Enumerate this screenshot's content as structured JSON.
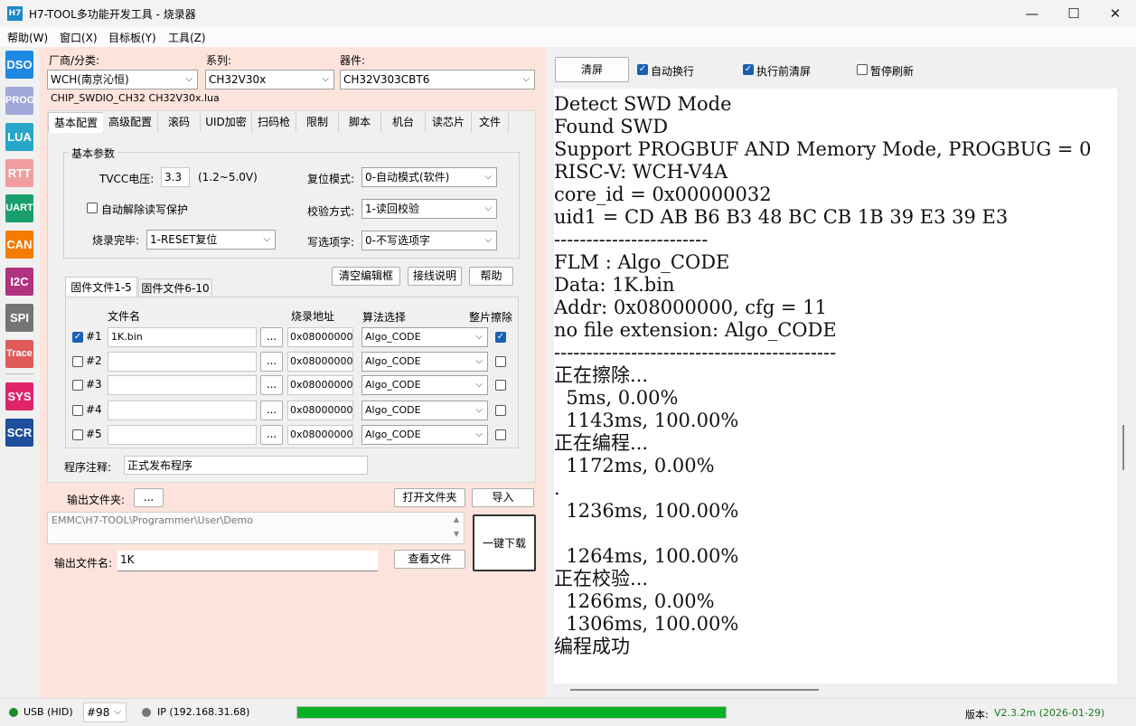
{
  "window": {
    "app_icon_text": "H7",
    "title": "H7-TOOL多功能开发工具 - 烧录器",
    "minimize": "—",
    "maximize": "☐",
    "close": "✕"
  },
  "menu": [
    "帮助(W)",
    "窗口(X)",
    "目标板(Y)",
    "工具(Z)"
  ],
  "toolbar": [
    {
      "label": "DSO",
      "color": "#1e88e5"
    },
    {
      "label": "PROG",
      "color": "#9fa8da"
    },
    {
      "label": "LUA",
      "color": "#26a6c9"
    },
    {
      "label": "RTT",
      "color": "#f29d9d"
    },
    {
      "label": "UART",
      "color": "#1b9e6e"
    },
    {
      "label": "CAN",
      "color": "#f57c00"
    },
    {
      "label": "I2C",
      "color": "#b0337f"
    },
    {
      "label": "SPI",
      "color": "#757575"
    },
    {
      "label": "Trace",
      "color": "#e05a5a"
    },
    {
      "label": "SYS",
      "color": "#e0246a"
    },
    {
      "label": "SCR",
      "color": "#1f4e9c"
    }
  ],
  "selectors": {
    "vendor_label": "厂商/分类:",
    "vendor_value": "WCH(南京沁恒)",
    "series_label": "系列:",
    "series_value": "CH32V30x",
    "device_label": "器件:",
    "device_value": "CH32V303CBT6",
    "script_info": "CHIP_SWDIO_CH32  CH32V30x.lua"
  },
  "tabs": [
    "基本配置",
    "高级配置",
    "滚码",
    "UID加密",
    "扫码枪",
    "限制",
    "脚本",
    "机台",
    "读芯片",
    "文件"
  ],
  "basic": {
    "group_title": "基本参数",
    "tvcc_label": "TVCC电压:",
    "tvcc_value": "3.3",
    "tvcc_range": "(1.2~5.0V)",
    "reset_label": "复位模式:",
    "reset_value": "0-自动模式(软件)",
    "auto_unlock_label": "自动解除读写保护",
    "verify_label": "校验方式:",
    "verify_value": "1-读回校验",
    "done_label": "烧录完毕:",
    "done_value": "1-RESET复位",
    "option_label": "写选项字:",
    "option_value": "0-不写选项字"
  },
  "file_buttons": {
    "clear": "清空编辑框",
    "wiring": "接线说明",
    "help": "帮助"
  },
  "file_tabs": [
    "固件文件1-5",
    "固件文件6-10"
  ],
  "file_table": {
    "headers": {
      "name": "文件名",
      "addr": "烧录地址",
      "algo": "算法选择",
      "erase": "整片擦除"
    },
    "browse": "...",
    "rows": [
      {
        "checked": true,
        "idx": "#1",
        "file": "1K.bin",
        "addr": "0x08000000",
        "algo": "Algo_CODE",
        "erase": true
      },
      {
        "checked": false,
        "idx": "#2",
        "file": "",
        "addr": "0x08000000",
        "algo": "Algo_CODE",
        "erase": false
      },
      {
        "checked": false,
        "idx": "#3",
        "file": "",
        "addr": "0x08000000",
        "algo": "Algo_CODE",
        "erase": false
      },
      {
        "checked": false,
        "idx": "#4",
        "file": "",
        "addr": "0x08000000",
        "algo": "Algo_CODE",
        "erase": false
      },
      {
        "checked": false,
        "idx": "#5",
        "file": "",
        "addr": "0x08000000",
        "algo": "Algo_CODE",
        "erase": false
      }
    ]
  },
  "note": {
    "label": "程序注释:",
    "value": "正式发布程序"
  },
  "output": {
    "folder_label": "输出文件夹:",
    "folder_btn": "...",
    "open_folder": "打开文件夹",
    "import": "导入",
    "path": "EMMC\\H7-TOOL\\Programmer\\User\\Demo",
    "download": "一键下载",
    "file_label": "输出文件名:",
    "file_value": "1K",
    "view_file": "查看文件"
  },
  "console_controls": {
    "clear": "清屏",
    "wrap_label": "自动换行",
    "wrap_checked": true,
    "pre_clear_label": "执行前清屏",
    "pre_clear_checked": true,
    "pause_label": "暂停刷新",
    "pause_checked": false
  },
  "console_lines": [
    "Detect SWD Mode",
    "Found SWD",
    "Support PROGBUF AND Memory Mode, PROGBUG = 0",
    "RISC-V: WCH-V4A",
    "core_id = 0x00000032",
    "uid1 = CD AB B6 B3 48 BC CB 1B 39 E3 39 E3",
    "------------------------",
    "FLM : Algo_CODE",
    "Data: 1K.bin",
    "Addr: 0x08000000, cfg = 11",
    "no file extension: Algo_CODE",
    "--------------------------------------------",
    "正在擦除...",
    "  5ms, 0.00%",
    "  1143ms, 100.00%",
    "正在编程...",
    "  1172ms, 0.00%",
    ".",
    "  1236ms, 100.00%",
    "",
    "  1264ms, 100.00%",
    "正在校验...",
    "  1266ms, 0.00%",
    "  1306ms, 100.00%",
    "编程成功"
  ],
  "status": {
    "usb": "USB (HID)",
    "usb_color": "#1b8a2e",
    "port": "#98",
    "ip": "IP (192.168.31.68)",
    "ip_color": "#777777",
    "progress": 1.0,
    "version_label": "版本:",
    "version_value": "V2.3.2m (2026-01-29)",
    "version_color": "#1b7a1b"
  }
}
